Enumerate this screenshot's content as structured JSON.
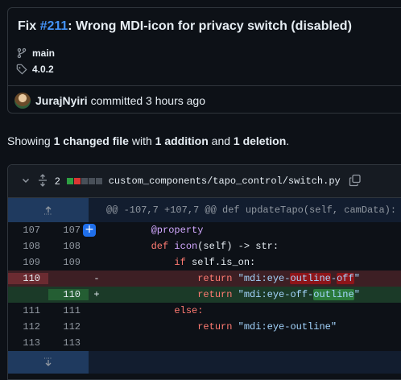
{
  "commit": {
    "title_prefix": "Fix ",
    "issue_ref": "#211",
    "title_rest": ": Wrong MDI-icon for privacy switch (disabled)",
    "branch": "main",
    "tag": "4.0.2",
    "author": "JurajNyiri",
    "committed_text": "committed 3 hours ago"
  },
  "summary": {
    "prefix": "Showing ",
    "changed": "1 changed file",
    "with": " with ",
    "additions": "1 addition",
    "and": " and ",
    "deletions": "1 deletion",
    "end": "."
  },
  "file": {
    "change_count": "2",
    "path": "custom_components/tapo_control/switch.py",
    "stat_colors": [
      "#2ea043",
      "#da3633",
      "#484f58",
      "#484f58",
      "#484f58"
    ],
    "hunk_header": "@@ -107,7 +107,7 @@ def updateTapo(self, camData):"
  },
  "lines": [
    {
      "old": "107",
      "new": "107",
      "mark": "",
      "type": "ctx"
    },
    {
      "old": "108",
      "new": "108",
      "mark": "",
      "type": "ctx"
    },
    {
      "old": "109",
      "new": "109",
      "mark": "",
      "type": "ctx"
    },
    {
      "old": "110",
      "new": "",
      "mark": "-",
      "type": "del"
    },
    {
      "old": "",
      "new": "110",
      "mark": "+",
      "type": "add"
    },
    {
      "old": "111",
      "new": "111",
      "mark": "",
      "type": "ctx"
    },
    {
      "old": "112",
      "new": "112",
      "mark": "",
      "type": "ctx"
    },
    {
      "old": "113",
      "new": "113",
      "mark": "",
      "type": "ctx"
    }
  ],
  "code": {
    "l107": "@property",
    "l108_def": "def ",
    "l108_fn": "icon",
    "l108_rest": "(self) -> str:",
    "l109_if": "if ",
    "l109_rest": "self.is_on:",
    "ret": "return ",
    "del_a": "\"mdi:eye-",
    "del_hl1": "outline",
    "del_b": "-",
    "del_hl2": "off",
    "del_c": "\"",
    "add_a": "\"mdi:eye-off-",
    "add_hl": "outline",
    "add_c": "\"",
    "l111": "else:",
    "l112_str": "\"mdi:eye-outline\""
  },
  "icons": {
    "branch": "git-branch-icon",
    "tag": "tag-icon",
    "copy": "copy-icon",
    "expand_up": "expand-up-icon",
    "expand_down": "expand-down-icon",
    "add_comment": "add-comment-icon",
    "chevron": "chevron-down-icon",
    "unfold": "unfold-icon"
  }
}
